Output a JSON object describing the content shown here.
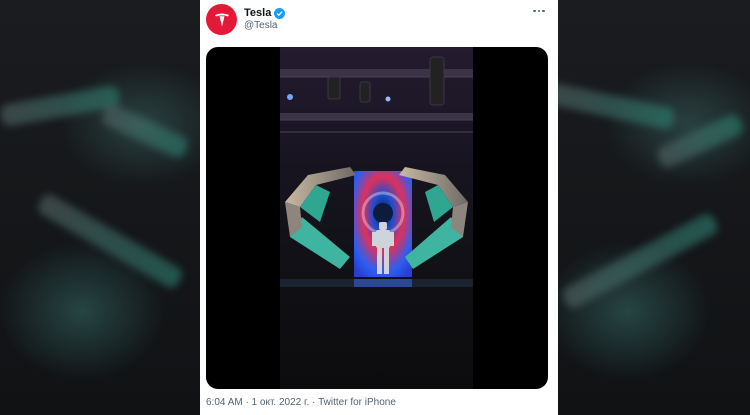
{
  "tweet": {
    "author_name": "Tesla",
    "author_handle": "@Tesla",
    "verified": true,
    "timestamp": "6:04 AM · 1 окт. 2022 г. · Twitter for iPhone"
  },
  "icons": {
    "avatar": "tesla-logo-icon",
    "verified": "verified-badge-icon",
    "more": "more-options-icon"
  },
  "colors": {
    "brand_red": "#e31937",
    "verified_blue": "#1d9bf0",
    "muted_text": "#536471"
  }
}
